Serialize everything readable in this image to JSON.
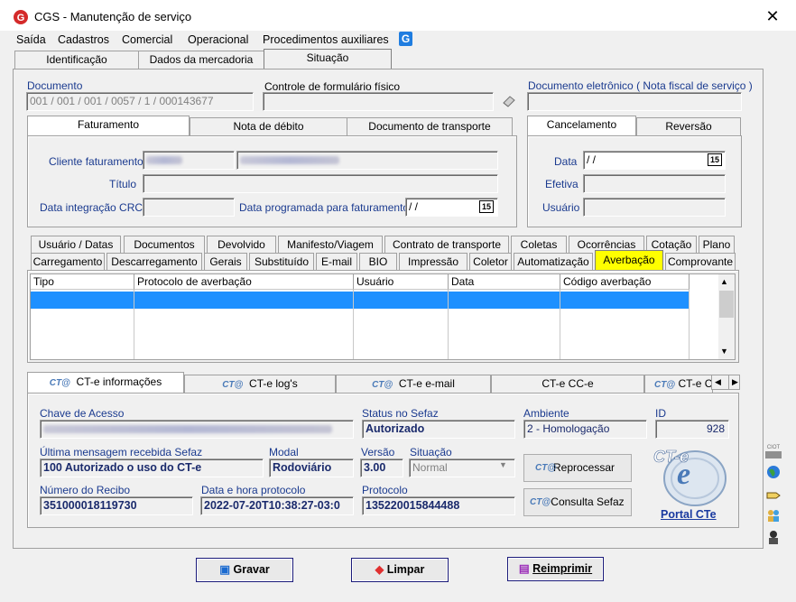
{
  "window": {
    "title": "CGS - Manutenção de serviço",
    "close": "✕"
  },
  "menu": [
    "Saída",
    "Cadastros",
    "Comercial",
    "Operacional",
    "Procedimentos auxiliares"
  ],
  "top_tabs": [
    "Identificação",
    "Dados da mercadoria",
    "Situação"
  ],
  "documento": {
    "label": "Documento",
    "value": "001 / 001 / 001 / 0057 / 1 / 000143677"
  },
  "controle": {
    "label": "Controle de formulário físico",
    "value": ""
  },
  "doc_eletronico": {
    "label": "Documento eletrônico ( Nota fiscal de serviço )",
    "value": ""
  },
  "fat_tabs": [
    "Faturamento",
    "Nota de débito",
    "Documento de transporte"
  ],
  "canc_tabs": [
    "Cancelamento",
    "Reversão"
  ],
  "faturamento": {
    "cliente_label": "Cliente faturamento",
    "titulo_label": "Título",
    "data_crc_label": "Data integração CRC",
    "data_prog_label": "Data programada para faturamento",
    "data_prog_value": " /  /"
  },
  "cancelamento": {
    "data_label": "Data",
    "data_value": " /  /",
    "efetiva_label": "Efetiva",
    "usuario_label": "Usuário"
  },
  "cal_icon": "15",
  "mid_tabs_row1": [
    "Usuário / Datas",
    "Documentos",
    "Devolvido",
    "Manifesto/Viagem",
    "Contrato de transporte",
    "Coletas",
    "Ocorrências",
    "Cotação",
    "Plano"
  ],
  "mid_tabs_row2": [
    "Carregamento",
    "Descarregamento",
    "Gerais",
    "Substituído",
    "E-mail",
    "BIO",
    "Impressão",
    "Coletor",
    "Automatização",
    "Averbação",
    "Comprovante"
  ],
  "grid_headers": [
    "Tipo",
    "Protocolo de averbação",
    "Usuário",
    "Data",
    "Código averbação"
  ],
  "cte_tabs": [
    "CT-e informações",
    "CT-e log's",
    "CT-e e-mail",
    "CT-e CC-e",
    "CT-e C"
  ],
  "cte": {
    "chave_label": "Chave de Acesso",
    "status_label": "Status no Sefaz",
    "status_value": "Autorizado",
    "ambiente_label": "Ambiente",
    "ambiente_value": "2 - Homologação",
    "id_label": "ID",
    "id_value": "928",
    "ultima_label": "Última mensagem recebida Sefaz",
    "ultima_value": "100 Autorizado o uso do CT-e",
    "modal_label": "Modal",
    "modal_value": "Rodoviário",
    "versao_label": "Versão",
    "versao_value": "3.00",
    "situacao_label": "Situação",
    "situacao_value": "Normal",
    "recibo_label": "Número do Recibo",
    "recibo_value": "351000018119730",
    "data_label": "Data e hora protocolo",
    "data_value": "2022-07-20T10:38:27-03:0",
    "protocolo_label": "Protocolo",
    "protocolo_value": "135220015844488",
    "reprocessar": "Reprocessar",
    "consulta": "Consulta Sefaz",
    "portal_link": "Portal CTe",
    "logo_text": "CT-e"
  },
  "buttons": {
    "gravar": "Gravar",
    "limpar": "Limpar",
    "reimprimir": "Reimprimir"
  },
  "side_label": "CIOT",
  "colors": {
    "accent": "#1a2a6c",
    "highlight": "#ffff00",
    "selection": "#1e90ff"
  }
}
